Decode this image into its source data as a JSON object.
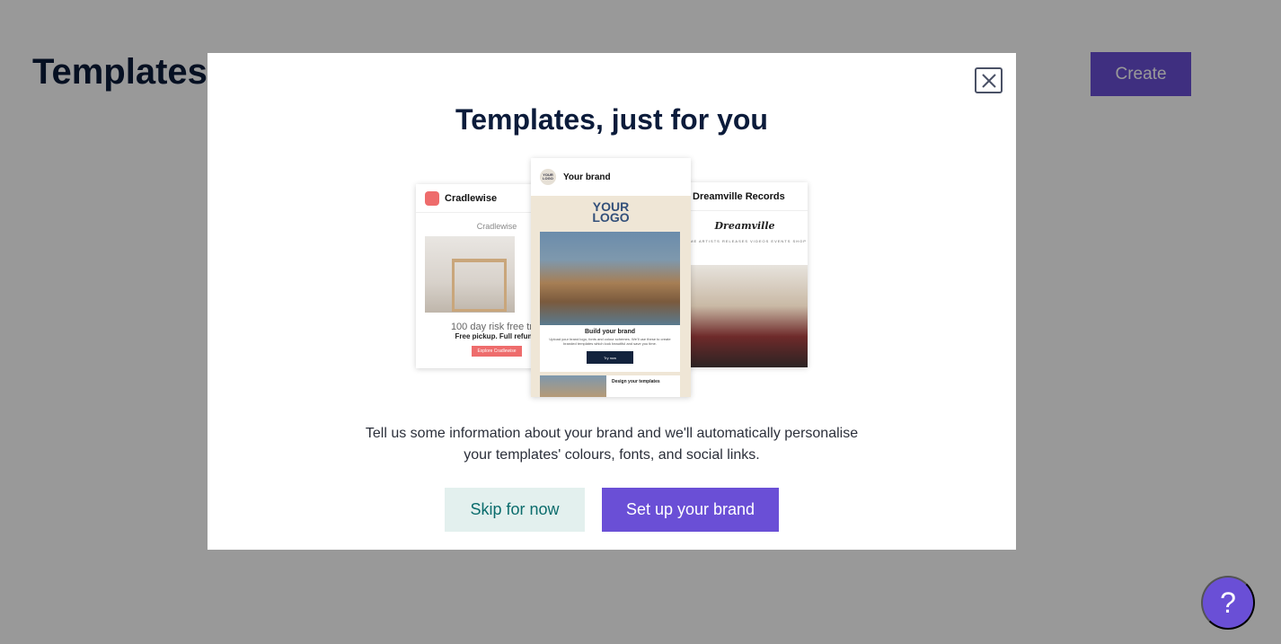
{
  "page": {
    "title": "Templates",
    "create_label": "Create",
    "help_label": "?"
  },
  "modal": {
    "title": "Templates, just for you",
    "description_line1": "Tell us some information about your brand and we'll automatically personalise",
    "description_line2": "your templates' colours, fonts, and social links.",
    "skip_label": "Skip for now",
    "setup_label": "Set up your brand"
  },
  "preview": {
    "left": {
      "brand": "Cradlewise",
      "logo_text": "Cradlewise",
      "trial_text": "100 day risk free trial",
      "trial_sub": "Free pickup. Full refund.",
      "cta": "Explore Cradlewise"
    },
    "center": {
      "brand": "Your brand",
      "chip_text": "YOUR LOGO",
      "logo_line1": "YOUR",
      "logo_line2": "LOGO",
      "build_title": "Build your brand",
      "build_text": "Upload your brand logo, fonts and colour schemes. We'll use these to create branded templates which look beautiful and save you time.",
      "cta": "Try now",
      "design_title": "Design your templates"
    },
    "right": {
      "brand": "Dreamville Records",
      "logo_text": "Dreamville",
      "nav_text": "HOME  ARTISTS  RELEASES  VIDEOS  EVENTS  SHOP"
    }
  },
  "colors": {
    "accent": "#6a4fd6",
    "skip_bg": "#e3f0ee",
    "skip_text": "#0a6c6c",
    "title_text": "#0b1b3a"
  }
}
